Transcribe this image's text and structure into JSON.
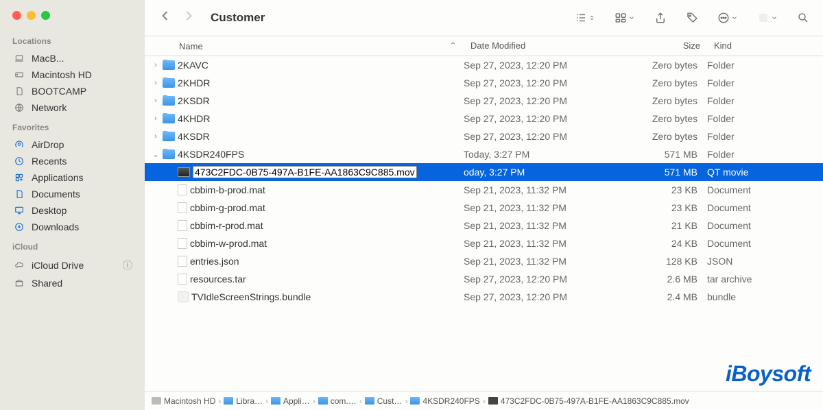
{
  "window": {
    "title": "Customer"
  },
  "sidebar": {
    "sections": [
      {
        "title": "Locations",
        "items": [
          {
            "icon": "laptop",
            "label": "MacB...",
            "color": "gray"
          },
          {
            "icon": "hdd",
            "label": "Macintosh HD",
            "color": "gray"
          },
          {
            "icon": "doc",
            "label": "BOOTCAMP",
            "color": "gray"
          },
          {
            "icon": "globe",
            "label": "Network",
            "color": "gray"
          }
        ]
      },
      {
        "title": "Favorites",
        "items": [
          {
            "icon": "airdrop",
            "label": "AirDrop",
            "color": "blue"
          },
          {
            "icon": "clock",
            "label": "Recents",
            "color": "blue"
          },
          {
            "icon": "app",
            "label": "Applications",
            "color": "blue"
          },
          {
            "icon": "doc",
            "label": "Documents",
            "color": "blue"
          },
          {
            "icon": "desktop",
            "label": "Desktop",
            "color": "blue"
          },
          {
            "icon": "download",
            "label": "Downloads",
            "color": "blue"
          }
        ]
      },
      {
        "title": "iCloud",
        "items": [
          {
            "icon": "cloud",
            "label": "iCloud Drive",
            "color": "gray",
            "extra": "ⓘ"
          },
          {
            "icon": "share",
            "label": "Shared",
            "color": "gray"
          }
        ]
      }
    ]
  },
  "columns": {
    "name": "Name",
    "date": "Date Modified",
    "size": "Size",
    "kind": "Kind"
  },
  "files": [
    {
      "indent": 0,
      "type": "folder",
      "expandable": true,
      "expanded": false,
      "name": "2KAVC",
      "date": "Sep 27, 2023, 12:20 PM",
      "size": "Zero bytes",
      "kind": "Folder"
    },
    {
      "indent": 0,
      "type": "folder",
      "expandable": true,
      "expanded": false,
      "name": "2KHDR",
      "date": "Sep 27, 2023, 12:20 PM",
      "size": "Zero bytes",
      "kind": "Folder"
    },
    {
      "indent": 0,
      "type": "folder",
      "expandable": true,
      "expanded": false,
      "name": "2KSDR",
      "date": "Sep 27, 2023, 12:20 PM",
      "size": "Zero bytes",
      "kind": "Folder"
    },
    {
      "indent": 0,
      "type": "folder",
      "expandable": true,
      "expanded": false,
      "name": "4KHDR",
      "date": "Sep 27, 2023, 12:20 PM",
      "size": "Zero bytes",
      "kind": "Folder"
    },
    {
      "indent": 0,
      "type": "folder",
      "expandable": true,
      "expanded": false,
      "name": "4KSDR",
      "date": "Sep 27, 2023, 12:20 PM",
      "size": "Zero bytes",
      "kind": "Folder"
    },
    {
      "indent": 0,
      "type": "folder",
      "expandable": true,
      "expanded": true,
      "name": "4KSDR240FPS",
      "date": "Today, 3:27 PM",
      "size": "571 MB",
      "kind": "Folder"
    },
    {
      "indent": 1,
      "type": "mov",
      "selected": true,
      "editing": true,
      "name": "473C2FDC-0B75-497A-B1FE-AA1863C9C885.mov",
      "date": "oday, 3:27 PM",
      "size": "571 MB",
      "kind": "QT movie"
    },
    {
      "indent": 1,
      "type": "doc",
      "name": "cbbim-b-prod.mat",
      "date": "Sep 21, 2023, 11:32 PM",
      "size": "23 KB",
      "kind": "Document"
    },
    {
      "indent": 1,
      "type": "doc",
      "name": "cbbim-g-prod.mat",
      "date": "Sep 21, 2023, 11:32 PM",
      "size": "23 KB",
      "kind": "Document"
    },
    {
      "indent": 1,
      "type": "doc",
      "name": "cbbim-r-prod.mat",
      "date": "Sep 21, 2023, 11:32 PM",
      "size": "21 KB",
      "kind": "Document"
    },
    {
      "indent": 1,
      "type": "doc",
      "name": "cbbim-w-prod.mat",
      "date": "Sep 21, 2023, 11:32 PM",
      "size": "24 KB",
      "kind": "Document"
    },
    {
      "indent": 1,
      "type": "doc",
      "name": "entries.json",
      "date": "Sep 21, 2023, 11:32 PM",
      "size": "128 KB",
      "kind": "JSON"
    },
    {
      "indent": 1,
      "type": "doc",
      "name": "resources.tar",
      "date": "Sep 27, 2023, 12:20 PM",
      "size": "2.6 MB",
      "kind": "tar archive"
    },
    {
      "indent": 1,
      "type": "bundle",
      "name": "TVIdleScreenStrings.bundle",
      "date": "Sep 27, 2023, 12:20 PM",
      "size": "2.4 MB",
      "kind": "bundle"
    }
  ],
  "path": [
    {
      "icon": "hd",
      "label": "Macintosh HD"
    },
    {
      "icon": "fld",
      "label": "Libra…"
    },
    {
      "icon": "fld",
      "label": "Appli…"
    },
    {
      "icon": "fld",
      "label": "com.…"
    },
    {
      "icon": "fld",
      "label": "Cust…"
    },
    {
      "icon": "fld",
      "label": "4KSDR240FPS"
    },
    {
      "icon": "mv",
      "label": "473C2FDC-0B75-497A-B1FE-AA1863C9C885.mov"
    }
  ],
  "watermark": "iBoysoft"
}
